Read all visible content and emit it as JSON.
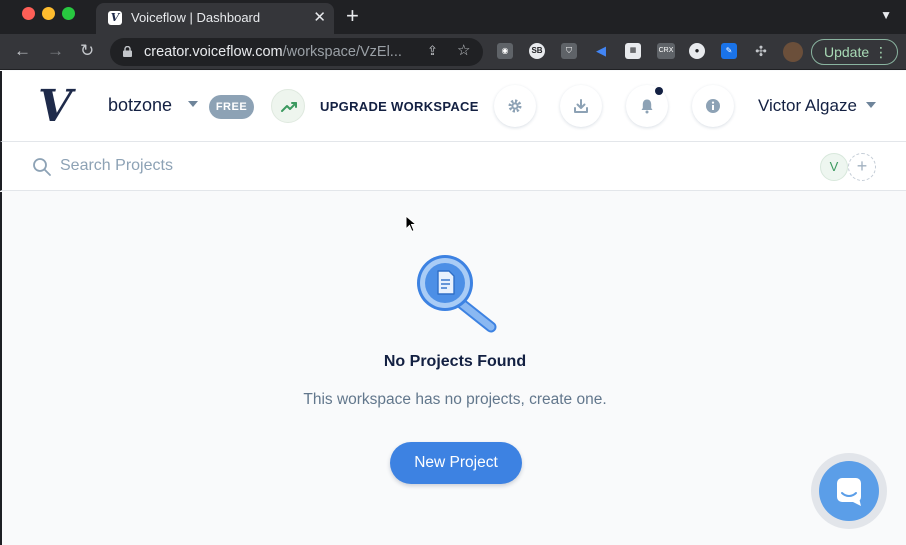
{
  "browser": {
    "tab_title": "Voiceflow | Dashboard",
    "tab_favicon_letter": "V",
    "url_host": "creator.voiceflow.com",
    "url_path": "/workspace/VzEl...",
    "update_label": "Update",
    "extensions": [
      "camera-icon",
      "sb-extension-icon",
      "shield-extension-icon",
      "megaphone-extension-icon",
      "wappalyzer-extension-icon",
      "crx-extension-icon",
      "lastpass-extension-icon",
      "pen-extension-icon",
      "puzzle-icon",
      "profile-avatar"
    ],
    "extension_labels": {
      "sb": "SB",
      "crx": "CRX"
    }
  },
  "header": {
    "logo": "V",
    "workspace_name": "botzone",
    "plan_badge": "FREE",
    "upgrade_label": "UPGRADE WORKSPACE",
    "user_name": "Victor Algaze"
  },
  "search": {
    "placeholder": "Search Projects",
    "value": "",
    "member_initial": "V",
    "add_member_symbol": "+"
  },
  "empty_state": {
    "title": "No Projects Found",
    "description": "This workspace has no projects, create one.",
    "button_label": "New Project"
  },
  "colors": {
    "brand_blue": "#3d82e2",
    "navy_text": "#132042",
    "free_badge": "#8da2b5",
    "upgrade_green": "#3c9a60"
  }
}
